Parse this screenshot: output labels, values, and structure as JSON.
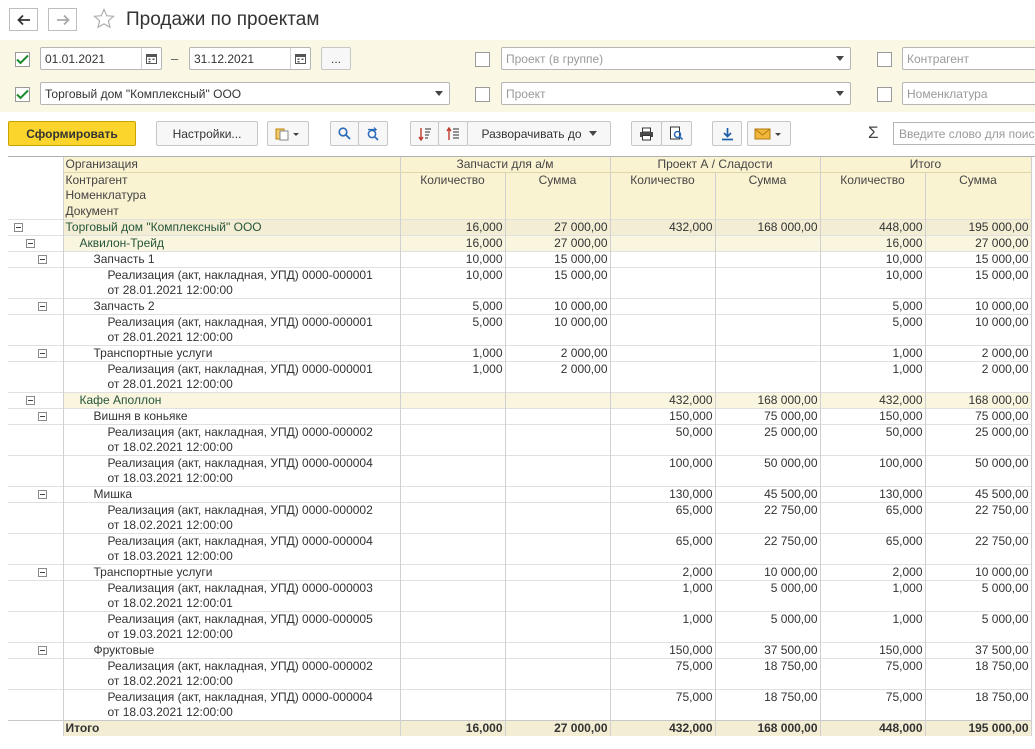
{
  "window": {
    "title": "Продажи по проектам"
  },
  "filters": {
    "date_from": "01.01.2021",
    "date_sep": "–",
    "date_to": "31.12.2021",
    "ellipsis": "...",
    "organization": "Торговый дом \"Комплексный\" ООО",
    "project_group_placeholder": "Проект (в группе)",
    "project_placeholder": "Проект",
    "contractor_placeholder": "Контрагент",
    "nomenclature_placeholder": "Номенклатура"
  },
  "toolbar": {
    "generate_label": "Сформировать",
    "settings_label": "Настройки...",
    "expand_label": "Разворачивать до",
    "sum_symbol": "Σ",
    "search_placeholder": "Введите слово для поиска"
  },
  "report": {
    "headers": {
      "rows": [
        "Организация",
        "Контрагент",
        "Номенклатура",
        "Документ"
      ],
      "group1": "Запчасти для а/м",
      "group2": "Проект А / Сладости",
      "group3": "Итого",
      "qty": "Количество",
      "sum": "Сумма"
    },
    "rows": [
      {
        "lvl": 0,
        "label": "Торговый дом \"Комплексный\" ООО",
        "label2": "",
        "v": [
          "16,000",
          "27 000,00",
          "432,000",
          "168 000,00",
          "448,000",
          "195 000,00"
        ]
      },
      {
        "lvl": 1,
        "label": "Аквилон-Трейд",
        "label2": "",
        "v": [
          "16,000",
          "27 000,00",
          "",
          "",
          "16,000",
          "27 000,00"
        ]
      },
      {
        "lvl": 2,
        "label": "Запчасть 1",
        "label2": "",
        "v": [
          "10,000",
          "15 000,00",
          "",
          "",
          "10,000",
          "15 000,00"
        ]
      },
      {
        "lvl": 3,
        "label": "Реализация (акт, накладная, УПД) 0000-000001",
        "label2": "от 28.01.2021 12:00:00",
        "v": [
          "10,000",
          "15 000,00",
          "",
          "",
          "10,000",
          "15 000,00"
        ]
      },
      {
        "lvl": 2,
        "label": "Запчасть 2",
        "label2": "",
        "v": [
          "5,000",
          "10 000,00",
          "",
          "",
          "5,000",
          "10 000,00"
        ]
      },
      {
        "lvl": 3,
        "label": "Реализация (акт, накладная, УПД) 0000-000001",
        "label2": "от 28.01.2021 12:00:00",
        "v": [
          "5,000",
          "10 000,00",
          "",
          "",
          "5,000",
          "10 000,00"
        ]
      },
      {
        "lvl": 2,
        "label": "Транспортные услуги",
        "label2": "",
        "v": [
          "1,000",
          "2 000,00",
          "",
          "",
          "1,000",
          "2 000,00"
        ]
      },
      {
        "lvl": 3,
        "label": "Реализация (акт, накладная, УПД) 0000-000001",
        "label2": "от 28.01.2021 12:00:00",
        "v": [
          "1,000",
          "2 000,00",
          "",
          "",
          "1,000",
          "2 000,00"
        ]
      },
      {
        "lvl": 1,
        "label": "Кафе Аполлон",
        "label2": "",
        "v": [
          "",
          "",
          "432,000",
          "168 000,00",
          "432,000",
          "168 000,00"
        ]
      },
      {
        "lvl": 2,
        "label": "Вишня в коньяке",
        "label2": "",
        "v": [
          "",
          "",
          "150,000",
          "75 000,00",
          "150,000",
          "75 000,00"
        ]
      },
      {
        "lvl": 3,
        "label": "Реализация (акт, накладная, УПД) 0000-000002",
        "label2": "от 18.02.2021 12:00:00",
        "v": [
          "",
          "",
          "50,000",
          "25 000,00",
          "50,000",
          "25 000,00"
        ]
      },
      {
        "lvl": 3,
        "label": "Реализация (акт, накладная, УПД) 0000-000004",
        "label2": "от 18.03.2021 12:00:00",
        "v": [
          "",
          "",
          "100,000",
          "50 000,00",
          "100,000",
          "50 000,00"
        ]
      },
      {
        "lvl": 2,
        "label": "Мишка",
        "label2": "",
        "v": [
          "",
          "",
          "130,000",
          "45 500,00",
          "130,000",
          "45 500,00"
        ]
      },
      {
        "lvl": 3,
        "label": "Реализация (акт, накладная, УПД) 0000-000002",
        "label2": "от 18.02.2021 12:00:00",
        "v": [
          "",
          "",
          "65,000",
          "22 750,00",
          "65,000",
          "22 750,00"
        ]
      },
      {
        "lvl": 3,
        "label": "Реализация (акт, накладная, УПД) 0000-000004",
        "label2": "от 18.03.2021 12:00:00",
        "v": [
          "",
          "",
          "65,000",
          "22 750,00",
          "65,000",
          "22 750,00"
        ]
      },
      {
        "lvl": 2,
        "label": "Транспортные услуги",
        "label2": "",
        "v": [
          "",
          "",
          "2,000",
          "10 000,00",
          "2,000",
          "10 000,00"
        ]
      },
      {
        "lvl": 3,
        "label": "Реализация (акт, накладная, УПД) 0000-000003",
        "label2": "от 18.02.2021 12:00:01",
        "v": [
          "",
          "",
          "1,000",
          "5 000,00",
          "1,000",
          "5 000,00"
        ]
      },
      {
        "lvl": 3,
        "label": "Реализация (акт, накладная, УПД) 0000-000005",
        "label2": "от 19.03.2021 12:00:00",
        "v": [
          "",
          "",
          "1,000",
          "5 000,00",
          "1,000",
          "5 000,00"
        ]
      },
      {
        "lvl": 2,
        "label": "Фруктовые",
        "label2": "",
        "v": [
          "",
          "",
          "150,000",
          "37 500,00",
          "150,000",
          "37 500,00"
        ]
      },
      {
        "lvl": 3,
        "label": "Реализация (акт, накладная, УПД) 0000-000002",
        "label2": "от 18.02.2021 12:00:00",
        "v": [
          "",
          "",
          "75,000",
          "18 750,00",
          "75,000",
          "18 750,00"
        ]
      },
      {
        "lvl": 3,
        "label": "Реализация (акт, накладная, УПД) 0000-000004",
        "label2": "от 18.03.2021 12:00:00",
        "v": [
          "",
          "",
          "75,000",
          "18 750,00",
          "75,000",
          "18 750,00"
        ]
      }
    ],
    "total": {
      "label": "Итого",
      "v": [
        "16,000",
        "27 000,00",
        "432,000",
        "168 000,00",
        "448,000",
        "195 000,00"
      ]
    }
  }
}
